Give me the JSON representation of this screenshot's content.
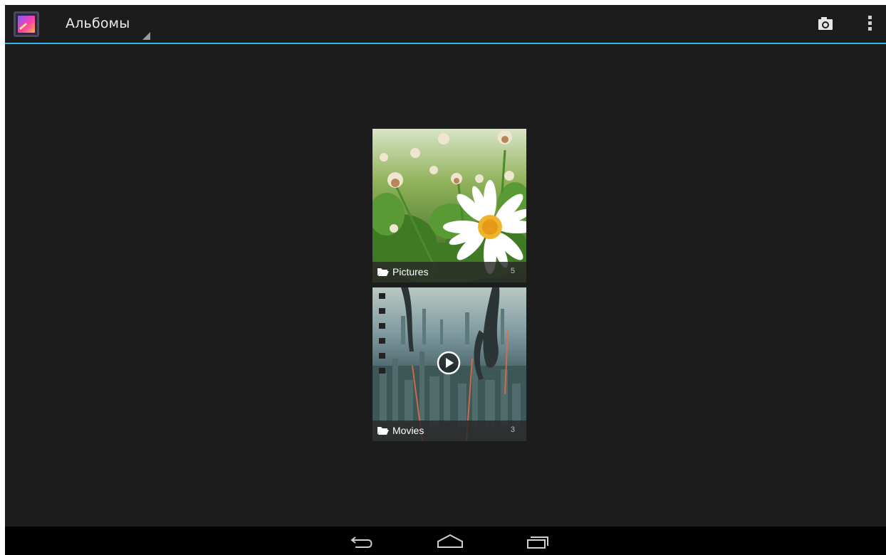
{
  "action_bar": {
    "title": "Альбомы",
    "accent_color": "#33b5e5",
    "app_icon": "gallery-icon",
    "actions": [
      "camera-icon",
      "overflow-menu-icon"
    ]
  },
  "albums": [
    {
      "name": "Pictures",
      "count": "5",
      "type": "images",
      "icon": "folder-icon"
    },
    {
      "name": "Movies",
      "count": "3",
      "type": "videos",
      "icon": "folder-icon",
      "overlay_icon": "play-icon"
    }
  ],
  "nav_bar": {
    "buttons": [
      "back-icon",
      "home-icon",
      "recent-apps-icon"
    ]
  }
}
